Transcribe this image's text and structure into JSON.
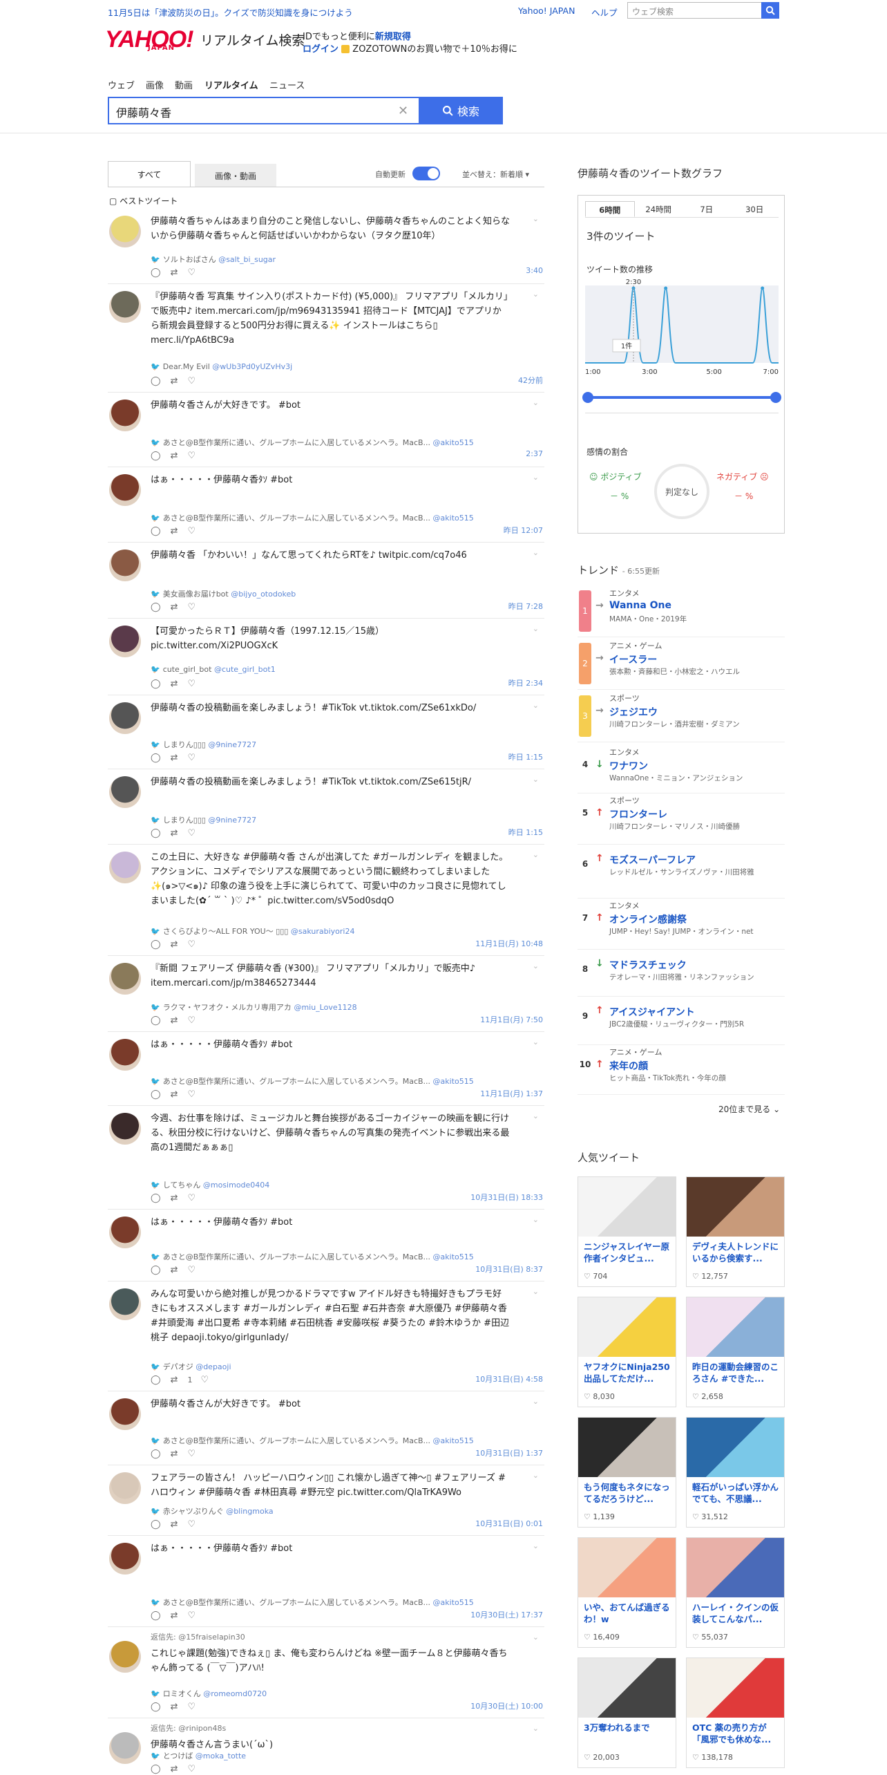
{
  "topbar": {
    "notice": "11月5日は「津波防災の日」。クイズで防災知識を身につけよう",
    "links": [
      "Yahoo! JAPAN",
      "ヘルプ"
    ],
    "search_placeholder": "ウェブ検索"
  },
  "header": {
    "logo": "YAHOO!",
    "logo_sub": "JAPAN",
    "service": "リアルタイム検索",
    "promo1_pre": "IDでもっと便利に",
    "promo1_link": "新規取得",
    "promo2_link": "ログイン",
    "promo2_text": "ZOZOTOWNのお買い物で＋10％お得に"
  },
  "nav": [
    "ウェブ",
    "画像",
    "動画",
    "リアルタイム",
    "ニュース"
  ],
  "search": {
    "query": "伊藤萌々香",
    "button": "検索"
  },
  "tabs": {
    "all": "すべて",
    "media": "画像・動画",
    "auto_update": "自動更新",
    "sort": "並べ替え：新着順"
  },
  "best_tweet_label": "ベストツイート",
  "tweets": [
    {
      "body": "伊藤萌々香ちゃんはあまり自分のこと発信しないし、伊藤萌々香ちゃんのことよく知らないから伊藤萌々香ちゃんと何話せばいいかわからない（ヲタク歴10年）",
      "user": "ソルトおばさん",
      "id": "@salt_bi_sugar",
      "time": "3:40",
      "color": "#e8d77a"
    },
    {
      "body": "『伊藤萌々香 写真集 サイン入り(ポストカード付) (¥5,000)』 フリマアプリ「メルカリ」で販売中♪ item.mercari.com/jp/m96943135941 招待コード【MTCJAJ】でアプリから新規会員登録すると500円分お得に買える✨ インストールはこちら▯ merc.li/YpA6tBC9a",
      "user": "Dear.My Evil",
      "id": "@wUb3Pd0yUZvHv3j",
      "time": "42分前",
      "color": "#6d6a5a"
    },
    {
      "body": "伊藤萌々香さんが大好きです。 #bot",
      "user": "あさと@B型作業所に通い、グループホームに入居しているメンヘラ。MacB...",
      "id": "@akito515",
      "time": "2:37",
      "color": "#7a3b2a"
    },
    {
      "body": "はぁ・・・・・伊藤萌々香ﾀｿ #bot",
      "user": "あさと@B型作業所に通い、グループホームに入居しているメンヘラ。MacB...",
      "id": "@akito515",
      "time": "昨日 12:07",
      "color": "#7a3b2a"
    },
    {
      "body": "伊藤萌々香 「かわいい！」なんて思ってくれたらRTを♪ twitpic.com/cq7o46",
      "user": "美女画像お届けbot",
      "id": "@bijyo_otodokeb",
      "time": "昨日 7:28",
      "color": "#8a5a44"
    },
    {
      "body": "【可愛かったらＲＴ】伊藤萌々香（1997.12.15／15歳） pic.twitter.com/Xi2PUOGXcK",
      "user": "cute_girl_bot",
      "id": "@cute_girl_bot1",
      "time": "昨日 2:34",
      "color": "#5a3a4a"
    },
    {
      "body": "伊藤萌々香の投稿動画を楽しみましょう！#TikTok vt.tiktok.com/ZSe61xkDo/",
      "user": "しまりん▯▯▯",
      "id": "@9nine7727",
      "time": "昨日 1:15",
      "color": "#555"
    },
    {
      "body": "伊藤萌々香の投稿動画を楽しみましょう！#TikTok vt.tiktok.com/ZSe615tjR/",
      "user": "しまりん▯▯▯",
      "id": "@9nine7727",
      "time": "昨日 1:15",
      "color": "#555"
    },
    {
      "body": "この土日に、大好きな #伊藤萌々香 さんが出演してた #ガールガンレディ を観ました。 アクションに、コメディでシリアスな展開であっという間に観終わってしまいました✨(๑>▽<๑)♪ 印象の違う役を上手に演じられてて、可愛い中のカッコ良さに見惚れてしまいました(✿´ ꒳ ` )♡ ♪* ゜pic.twitter.com/sV5od0sdqO",
      "user": "さくらびより～ALL FOR YOU～ ▯▯▯",
      "id": "@sakurabiyori24",
      "time": "11月1日(月) 10:48",
      "color": "#c9b8d8"
    },
    {
      "body": "『新闘 フェアリーズ 伊藤萌々香 (¥300)』 フリマアプリ「メルカリ」で販売中♪ item.mercari.com/jp/m38465273444",
      "user": "ラクマ・ヤフオク・メルカリ専用アカ",
      "id": "@miu_Love1128",
      "time": "11月1日(月) 7:50",
      "color": "#8a7a5a"
    },
    {
      "body": "はぁ・・・・・伊藤萌々香ﾀｿ #bot",
      "user": "あさと@B型作業所に通い、グループホームに入居しているメンヘラ。MacB...",
      "id": "@akito515",
      "time": "11月1日(月) 1:37",
      "color": "#7a3b2a"
    },
    {
      "body": "今週、お仕事を除けば、ミュージカルと舞台挨拶があるゴーカイジャーの映画を観に行ける、秋田分校に行けないけど、伊藤萌々香ちゃんの写真集の発売イベントに参戦出来る最高の1週間だぁぁぁ▯",
      "user": "してちゃん",
      "id": "@mosimode0404",
      "time": "10月31日(日) 18:33",
      "color": "#3a2a2a"
    },
    {
      "body": "はぁ・・・・・伊藤萌々香ﾀｿ #bot",
      "user": "あさと@B型作業所に通い、グループホームに入居しているメンヘラ。MacB...",
      "id": "@akito515",
      "time": "10月31日(日) 8:37",
      "color": "#7a3b2a"
    },
    {
      "body": "みんな可愛いから絶対推しが見つかるドラマですw アイドル好きも特撮好きもプラモ好きにもオススメします #ガールガンレディ #白石聖 #石井杏奈 #大原優乃 #伊藤萌々香 #井頭愛海 #出口夏希 #寺本莉緒 #石田桃香 #安藤咲桜 #葵うたの #鈴木ゆうか #田辺桃子 depaoji.tokyo/girlgunlady/",
      "user": "デパオジ",
      "id": "@depaoji",
      "time": "10月31日(日) 4:58",
      "color": "#4a5a5a",
      "rt": "1"
    },
    {
      "body": "伊藤萌々香さんが大好きです。 #bot",
      "user": "あさと@B型作業所に通い、グループホームに入居しているメンヘラ。MacB...",
      "id": "@akito515",
      "time": "10月31日(日) 1:37",
      "color": "#7a3b2a"
    },
    {
      "body": "フェアラーの皆さん！ ハッピーハロウィン▯▯ これ懐かし過ぎて神〜▯ #フェアリーズ #ハロウィン #伊藤萌々香 #林田真尋 #野元空 pic.twitter.com/QlaTrKA9Wo",
      "user": "赤シャツぷりんぐ",
      "id": "@blingmoka",
      "time": "10月31日(日) 0:01",
      "color": "#d8c8b8"
    },
    {
      "body": "はぁ・・・・・伊藤萌々香ﾀｿ #bot",
      "user": "あさと@B型作業所に通い、グループホームに入居しているメンヘラ。MacB...",
      "id": "@akito515",
      "time": "10月30日(土) 17:37",
      "color": "#7a3b2a"
    },
    {
      "reply": "返信先: @15fraiselapin30",
      "body": "これじゃ課題(勉強)できねぇ▯ ま、俺も変わらんけどね ※壁一面チーム８と伊藤萌々香ちゃん飾ってる (￣▽￣)アハﾊ!",
      "user": "ロミオくん",
      "id": "@romeomd0720",
      "time": "10月30日(土) 10:00",
      "color": "#c89a3a"
    },
    {
      "reply": "返信先: @rinipon48s",
      "body": "伊藤萌々香さん言うまい(´ω`)",
      "user": "とつけば",
      "id": "@moka_totte",
      "time": "",
      "color": "#bbb"
    }
  ],
  "graph": {
    "title": "伊藤萌々香のツイート数グラフ",
    "tabs": [
      "6時間",
      "24時間",
      "7日",
      "30日"
    ],
    "count": "3件のツイート",
    "sub": "ツイート数の推移",
    "peak_time": "2:30",
    "tooltip": "1件",
    "xlabels": [
      "1:00",
      "3:00",
      "5:00",
      "7:00"
    ],
    "sentiment_title": "感情の割合",
    "positive": "ポジティブ",
    "negative": "ネガティブ",
    "neutral": "判定なし",
    "pos_val": "－ %",
    "neg_val": "－ %"
  },
  "chart_data": {
    "type": "line",
    "x": [
      "1:00",
      "2:30",
      "3:30",
      "6:30",
      "7:00"
    ],
    "series": [
      {
        "values": [
          0,
          1,
          1,
          1,
          0
        ]
      }
    ],
    "annotations": [
      "2:30",
      "1件"
    ]
  },
  "trends": {
    "title": "トレンド",
    "updated": "6:55更新",
    "more": "20位まで見る",
    "items": [
      {
        "rank": "1",
        "cat": "エンタメ",
        "name": "Wanna One",
        "sub": "MAMA・One・2019年",
        "arrow": "→",
        "acolor": "#888",
        "rcolor": "#f0808a"
      },
      {
        "rank": "2",
        "cat": "アニメ・ゲーム",
        "name": "イースラー",
        "sub": "張本勲・斉藤和巳・小林宏之・ハウエル",
        "arrow": "→",
        "acolor": "#888",
        "rcolor": "#f5a06a"
      },
      {
        "rank": "3",
        "cat": "スポーツ",
        "name": "ジェジエウ",
        "sub": "川崎フロンターレ・酒井宏樹・ダミアン",
        "arrow": "→",
        "acolor": "#888",
        "rcolor": "#f5cd50"
      },
      {
        "rank": "4",
        "cat": "エンタメ",
        "name": "ワナワン",
        "sub": "WannaOne・ミニョン・アンジェション",
        "arrow": "↓",
        "acolor": "#3a9a4a",
        "rcolor": ""
      },
      {
        "rank": "5",
        "cat": "スポーツ",
        "name": "フロンターレ",
        "sub": "川崎フロンターレ・マリノス・川崎優勝",
        "arrow": "↑",
        "acolor": "#e0403a",
        "rcolor": ""
      },
      {
        "rank": "6",
        "cat": "",
        "name": "モズスーパーフレア",
        "sub": "レッドルゼル・サンライズノヴァ・川田将雅",
        "arrow": "↑",
        "acolor": "#e0403a",
        "rcolor": ""
      },
      {
        "rank": "7",
        "cat": "エンタメ",
        "name": "オンライン感謝祭",
        "sub": "JUMP・Hey! Say! JUMP・オンライン・net",
        "arrow": "↑",
        "acolor": "#e0403a",
        "rcolor": ""
      },
      {
        "rank": "8",
        "cat": "",
        "name": "マドラスチェック",
        "sub": "テオレーマ・川田将雅・リネンファッション",
        "arrow": "↓",
        "acolor": "#3a9a4a",
        "rcolor": ""
      },
      {
        "rank": "9",
        "cat": "",
        "name": "アイスジャイアント",
        "sub": "JBC2歳優駿・リューヴィクター・門別5R",
        "arrow": "↑",
        "acolor": "#e0403a",
        "rcolor": ""
      },
      {
        "rank": "10",
        "cat": "アニメ・ゲーム",
        "name": "来年の顔",
        "sub": "ヒット商品・TikTok売れ・今年の顔",
        "arrow": "↑",
        "acolor": "#e0403a",
        "rcolor": ""
      }
    ]
  },
  "popular": {
    "title": "人気ツイート",
    "cards": [
      {
        "title": "ニンジャスレイヤー原作者インタビュ...",
        "likes": "704",
        "c1": "#f4f4f4",
        "c2": "#ddd"
      },
      {
        "title": "デヴィ夫人トレンドにいるから倹索す...",
        "likes": "12,757",
        "c1": "#5a3a2a",
        "c2": "#c89a7a"
      },
      {
        "title": "ヤフオクにNinja250出品してただけ...",
        "likes": "8,030",
        "c1": "#f0f0f0",
        "c2": "#f5d040"
      },
      {
        "title": "昨日の運動会練習のころさん #できた...",
        "likes": "2,658",
        "c1": "#f0e0f0",
        "c2": "#8ab0d8"
      },
      {
        "title": "もう何度もネタになってるだろうけど...",
        "likes": "1,139",
        "c1": "#2a2a2a",
        "c2": "#c8c0b8"
      },
      {
        "title": "軽石がいっぱい浮かんでても、不思議...",
        "likes": "31,512",
        "c1": "#2a6aa8",
        "c2": "#7ac8e8"
      },
      {
        "title": "いや、おてんば過ぎるわ！w",
        "likes": "16,409",
        "c1": "#f0d8c8",
        "c2": "#f5a080"
      },
      {
        "title": "ハーレイ・クインの仮装してこんなパ...",
        "likes": "55,037",
        "c1": "#e8b0a8",
        "c2": "#4a6ab8"
      },
      {
        "title": "3万奪われるまで",
        "likes": "20,003",
        "c1": "#e8e8e8",
        "c2": "#444"
      },
      {
        "title": "OTC 薬の売り方が「風邪でも休めな...",
        "likes": "138,178",
        "c1": "#f5f0e8",
        "c2": "#e03a3a"
      }
    ]
  }
}
